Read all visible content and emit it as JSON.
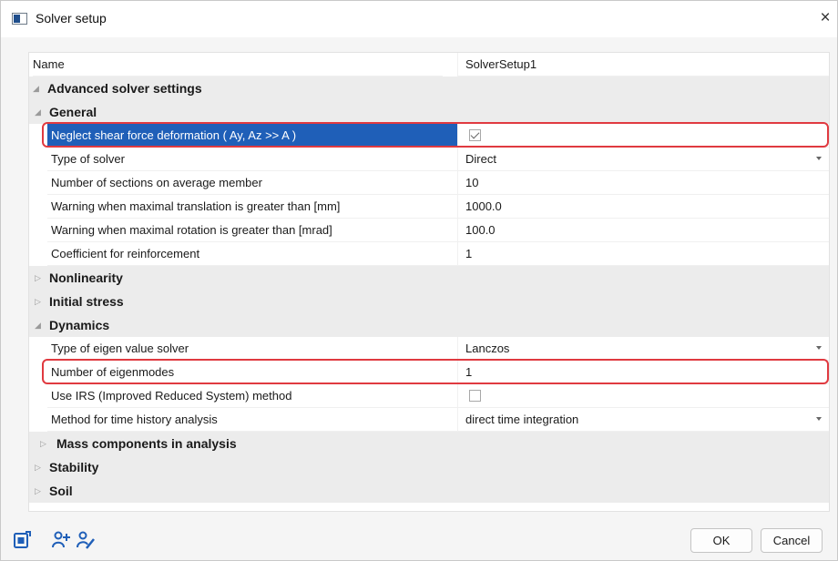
{
  "window": {
    "title": "Solver setup",
    "close_glyph": "×"
  },
  "grid": {
    "name_row": {
      "label": "Name",
      "value": "SolverSetup1"
    },
    "advanced": {
      "label": "Advanced solver settings",
      "expander": "◢"
    },
    "general": {
      "label": "General",
      "expander": "◢",
      "items": [
        {
          "label": "Neglect shear force deformation ( Ay, Az >> A )",
          "type": "checkbox",
          "checked": true
        },
        {
          "label": "Type of solver",
          "value": "Direct",
          "type": "dropdown"
        },
        {
          "label": "Number of sections on average member",
          "value": "10"
        },
        {
          "label": "Warning when maximal translation is greater than [mm]",
          "value": "1000.0"
        },
        {
          "label": "Warning when maximal rotation is greater than [mrad]",
          "value": "100.0"
        },
        {
          "label": "Coefficient for reinforcement",
          "value": "1"
        }
      ]
    },
    "nonlinearity": {
      "label": "Nonlinearity",
      "expander": "▷"
    },
    "initial_stress": {
      "label": "Initial stress",
      "expander": "▷"
    },
    "dynamics": {
      "label": "Dynamics",
      "expander": "◢",
      "items": [
        {
          "label": "Type of eigen value solver",
          "value": "Lanczos",
          "type": "dropdown"
        },
        {
          "label": "Number of eigenmodes",
          "value": "1"
        },
        {
          "label": "Use IRS (Improved Reduced System) method",
          "type": "checkbox",
          "checked": false
        },
        {
          "label": "Method for time history analysis",
          "value": "direct time integration",
          "type": "dropdown"
        }
      ]
    },
    "mass_components": {
      "label": "Mass components in analysis",
      "expander": "▷"
    },
    "stability": {
      "label": "Stability",
      "expander": "▷"
    },
    "soil": {
      "label": "Soil",
      "expander": "▷"
    }
  },
  "footer": {
    "tools": [
      {
        "name": "export-icon"
      },
      {
        "name": "add-user-icon"
      },
      {
        "name": "edit-user-icon"
      }
    ],
    "ok_label": "OK",
    "cancel_label": "Cancel"
  },
  "colors": {
    "selection": "#1f5fb8",
    "highlight": "#e03a40",
    "group_background": "#ececec",
    "tool_icon": "#1f5fb8"
  }
}
